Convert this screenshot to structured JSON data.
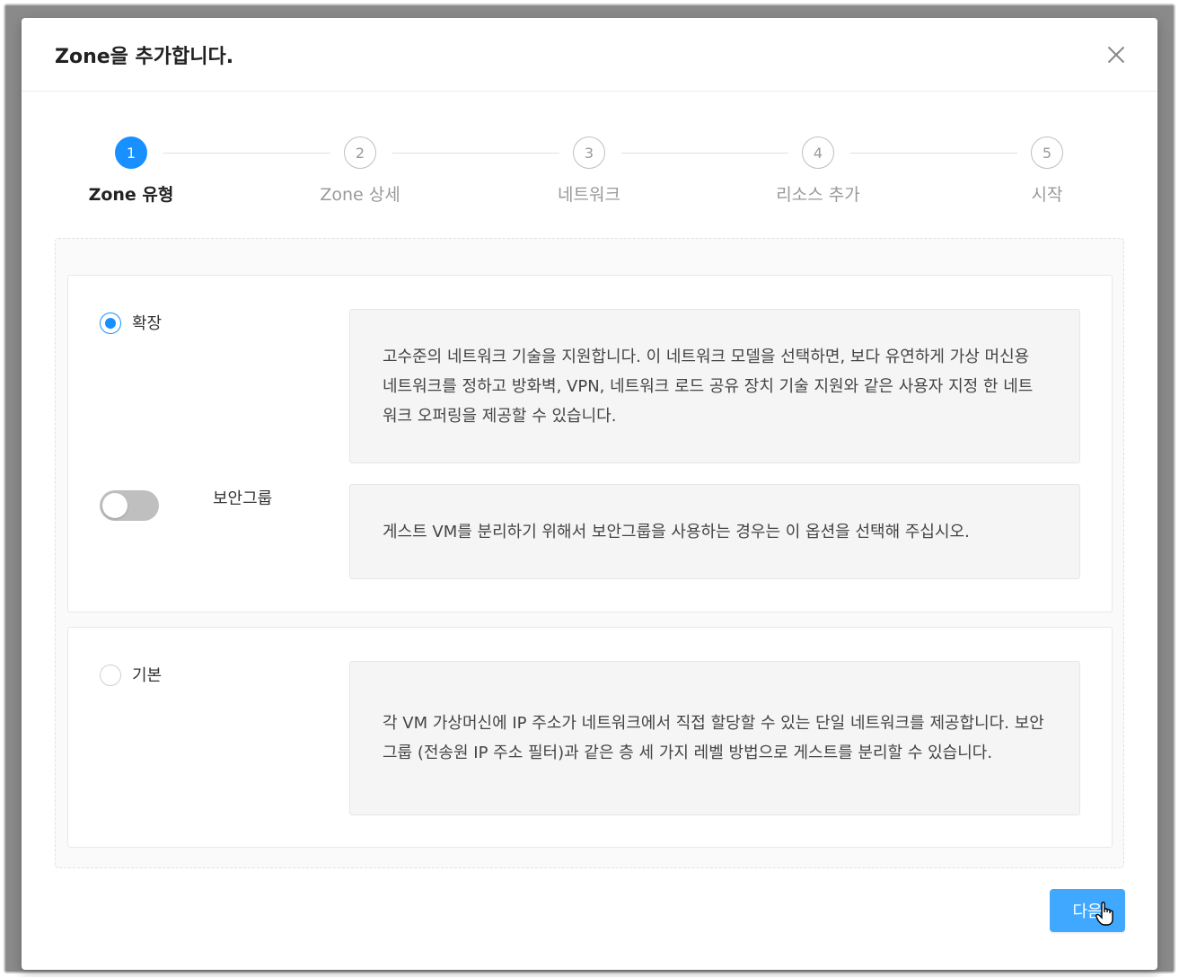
{
  "modal": {
    "title": "Zone을 추가합니다.",
    "close_label": "X"
  },
  "steps": [
    {
      "number": "1",
      "label": "Zone 유형",
      "active": true
    },
    {
      "number": "2",
      "label": "Zone 상세",
      "active": false
    },
    {
      "number": "3",
      "label": "네트워크",
      "active": false
    },
    {
      "number": "4",
      "label": "리소스 추가",
      "active": false
    },
    {
      "number": "5",
      "label": "시작",
      "active": false
    }
  ],
  "advanced": {
    "label": "확장",
    "selected": true,
    "description": "고수준의 네트워크 기술을 지원합니다. 이 네트워크 모델을 선택하면, 보다 유연하게 가상 머신용 네트워크를 정하고 방화벽, VPN, 네트워크 로드 공유 장치 기술 지원와 같은 사용자 지정 한 네트워크 오퍼링을 제공할 수 있습니다.",
    "security_group": {
      "label": "보안그룹",
      "enabled": false,
      "description": "게스트 VM를 분리하기 위해서 보안그룹을 사용하는 경우는 이 옵션을 선택해 주십시오."
    }
  },
  "basic": {
    "label": "기본",
    "selected": false,
    "description": "각 VM 가상머신에 IP 주소가 네트워크에서 직접 할당할 수 있는 단일 네트워크를 제공합니다. 보안그룹 (전송원 IP 주소 필터)과 같은 층 세 가지 레벨 방법으로 게스트를 분리할 수 있습니다."
  },
  "footer": {
    "next_label": "다음"
  },
  "colors": {
    "primary": "#1890ff",
    "button": "#40a9ff"
  }
}
